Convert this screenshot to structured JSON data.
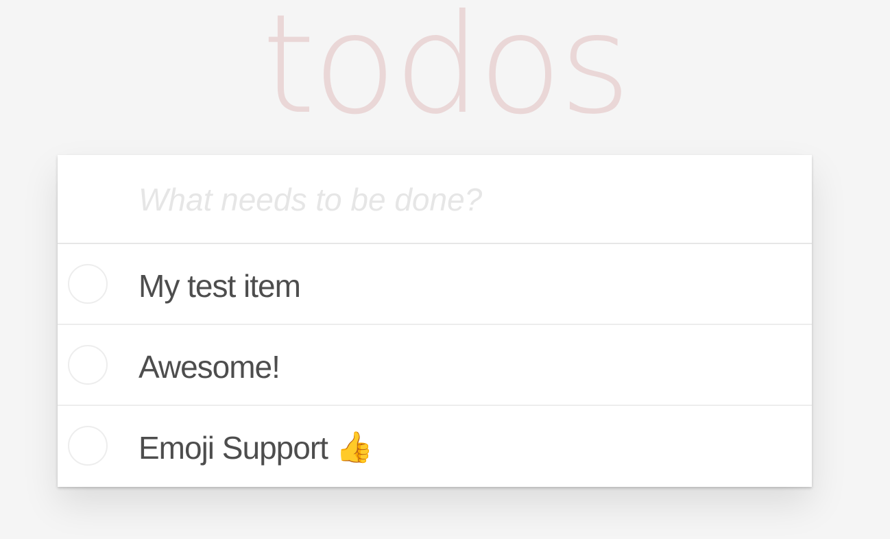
{
  "header": {
    "title": "todos"
  },
  "new_todo": {
    "placeholder": "What needs to be done?",
    "value": ""
  },
  "todos": [
    {
      "label": "My test item",
      "completed": false
    },
    {
      "label": "Awesome!",
      "completed": false
    },
    {
      "label": "Emoji Support",
      "emoji": "👍",
      "completed": false
    }
  ],
  "colors": {
    "background": "#f5f5f5",
    "title": "#ead7d7",
    "text": "#4d4d4d",
    "placeholder": "#e6e6e6",
    "border": "#ededed"
  }
}
